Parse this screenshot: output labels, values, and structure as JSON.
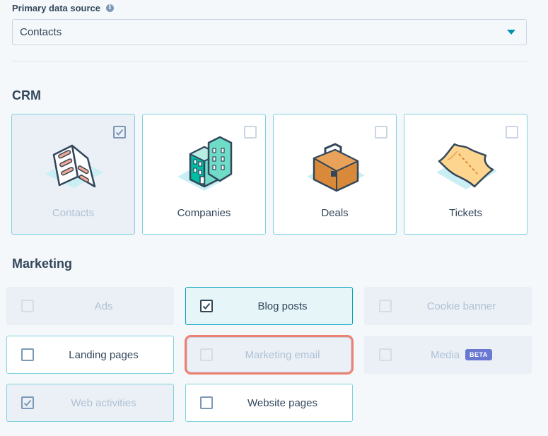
{
  "data_source": {
    "label": "Primary data source",
    "info_icon": "info-icon",
    "selected_value": "Contacts"
  },
  "crm": {
    "title": "CRM",
    "cards": [
      {
        "label": "Contacts",
        "icon": "contacts-illustration",
        "checked": true,
        "disabled": true
      },
      {
        "label": "Companies",
        "icon": "companies-illustration",
        "checked": false
      },
      {
        "label": "Deals",
        "icon": "deals-illustration",
        "checked": false
      },
      {
        "label": "Tickets",
        "icon": "tickets-illustration",
        "checked": false
      }
    ]
  },
  "marketing": {
    "title": "Marketing",
    "items": [
      {
        "label": "Ads",
        "checked": false,
        "disabled": true
      },
      {
        "label": "Blog posts",
        "checked": true,
        "disabled": false
      },
      {
        "label": "Cookie banner",
        "checked": false,
        "disabled": true
      },
      {
        "label": "Landing pages",
        "checked": false,
        "disabled": false
      },
      {
        "label": "Marketing email",
        "checked": false,
        "disabled": true,
        "focused": true
      },
      {
        "label": "Media",
        "checked": false,
        "disabled": true,
        "badge": "BETA"
      },
      {
        "label": "Web activities",
        "checked": true,
        "disabled": true
      },
      {
        "label": "Website pages",
        "checked": false,
        "disabled": false
      }
    ]
  },
  "colors": {
    "accent": "#00a4bd",
    "caret": "#0091ae",
    "focus_ring": "#ee8071",
    "beta_badge": "#6a78d1"
  }
}
